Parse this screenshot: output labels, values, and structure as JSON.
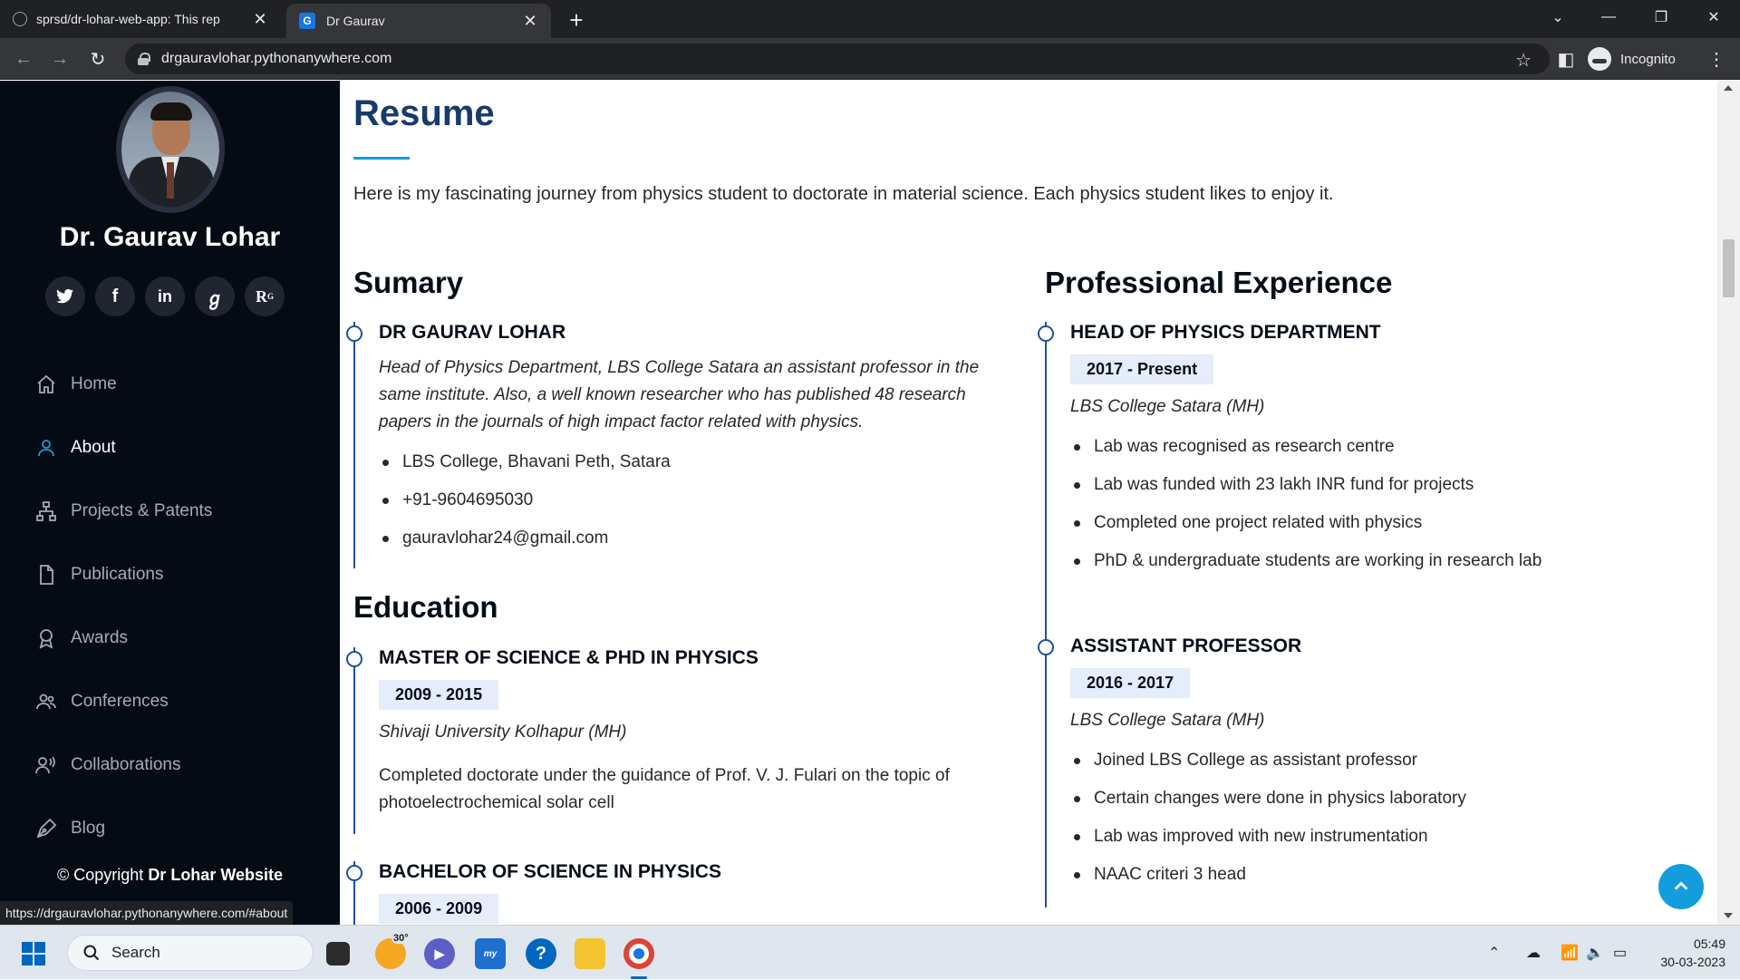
{
  "browser": {
    "tabs": [
      {
        "title": "sprsd/dr-lohar-web-app: This rep"
      },
      {
        "title": "Dr Gaurav",
        "favicon": "G"
      }
    ],
    "address": "drgauravlohar.pythonanywhere.com",
    "profile_label": "Incognito",
    "status_url": "https://drgauravlohar.pythonanywhere.com/#about"
  },
  "sidebar": {
    "name": "Dr. Gaurav Lohar",
    "socials": [
      {
        "icon": "twitter-icon",
        "glyph": "t"
      },
      {
        "icon": "facebook-icon",
        "glyph": "f"
      },
      {
        "icon": "linkedin-icon",
        "glyph": "in"
      },
      {
        "icon": "google-scholar-icon",
        "glyph": "g"
      },
      {
        "icon": "researchgate-icon",
        "glyph": "R"
      }
    ],
    "nav": [
      {
        "label": "Home",
        "icon": "house-icon",
        "active": false
      },
      {
        "label": "About",
        "icon": "person-icon",
        "active": true
      },
      {
        "label": "Projects & Patents",
        "icon": "diagram-icon",
        "active": false
      },
      {
        "label": "Publications",
        "icon": "file-icon",
        "active": false
      },
      {
        "label": "Awards",
        "icon": "award-icon",
        "active": false
      },
      {
        "label": "Conferences",
        "icon": "people-icon",
        "active": false
      },
      {
        "label": "Collaborations",
        "icon": "person-voice-icon",
        "active": false
      },
      {
        "label": "Blog",
        "icon": "pen-icon",
        "active": false
      }
    ],
    "copyright_prefix": "© Copyright",
    "copyright_site": "Dr Lohar Website"
  },
  "resume": {
    "title": "Resume",
    "intro": "Here is my fascinating journey from physics student to doctorate in material science. Each physics student likes to enjoy it.",
    "summary": {
      "heading": "Sumary",
      "name": "DR GAURAV LOHAR",
      "description": "Head of Physics Department, LBS College Satara an assistant professor in the same institute. Also, a well known researcher who has published 48 research papers in the journals of high impact factor related with physics.",
      "contacts": [
        "LBS College, Bhavani Peth, Satara",
        "+91-9604695030",
        "gauravlohar24@gmail.com"
      ]
    },
    "education": {
      "heading": "Education",
      "items": [
        {
          "title": "MASTER OF SCIENCE & PHD IN PHYSICS",
          "period": "2009 - 2015",
          "institution": "Shivaji University Kolhapur (MH)",
          "text": "Completed doctorate under the guidance of Prof. V. J. Fulari on the topic of photoelectrochemical solar cell"
        },
        {
          "title": "BACHELOR OF SCIENCE IN PHYSICS",
          "period": "2006 - 2009"
        }
      ]
    },
    "experience": {
      "heading": "Professional Experience",
      "items": [
        {
          "title": "HEAD OF PHYSICS DEPARTMENT",
          "period": "2017 - Present",
          "institution": "LBS College Satara (MH)",
          "points": [
            "Lab was recognised as research centre",
            "Lab was funded with 23 lakh INR fund for projects",
            "Completed one project related with physics",
            "PhD & undergraduate students are working in research lab"
          ]
        },
        {
          "title": "ASSISTANT PROFESSOR",
          "period": "2016 - 2017",
          "institution": "LBS College Satara (MH)",
          "points": [
            "Joined LBS College as assistant professor",
            "Certain changes were done in physics laboratory",
            "Lab was improved with new instrumentation",
            "NAAC criteri 3 head"
          ]
        }
      ]
    }
  },
  "taskbar": {
    "search_placeholder": "Search",
    "weather_temp": "30°",
    "time": "05:49",
    "date": "30-03-2023"
  },
  "colors": {
    "sidebar_bg": "#040b14",
    "accent": "#149ddd",
    "heading": "#173b6c",
    "timeline": "#1f5297"
  }
}
